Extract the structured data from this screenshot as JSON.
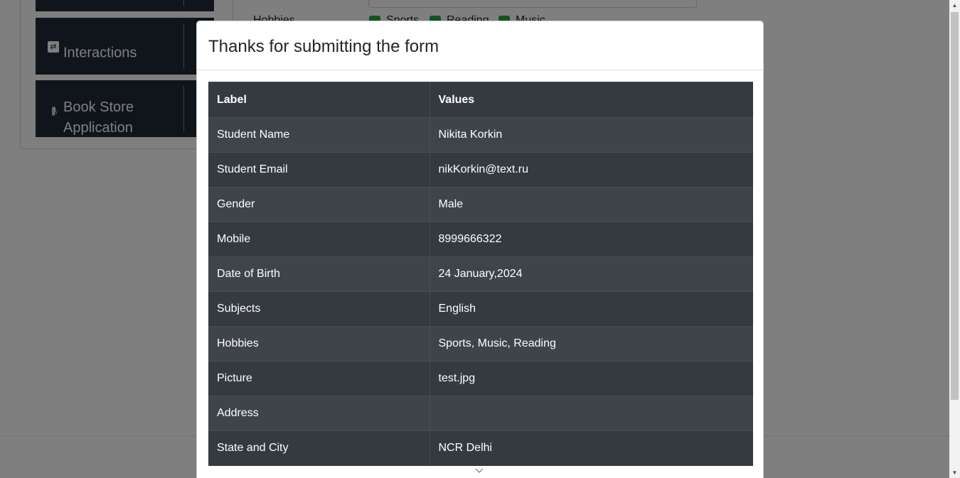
{
  "background": {
    "sidebar": {
      "groups": [
        {
          "label": "",
          "icon": ""
        },
        {
          "label": "Interactions",
          "icon": "interactions-icon"
        },
        {
          "label": "Book Store Application",
          "icon": "book-store-icon"
        }
      ]
    },
    "form": {
      "hobbies_label": "Hobbies",
      "hobby_options": [
        "Sports",
        "Reading",
        "Music"
      ]
    }
  },
  "modal": {
    "title": "Thanks for submitting the form",
    "table": {
      "headers": [
        "Label",
        "Values"
      ],
      "rows": [
        {
          "label": "Student Name",
          "value": "Nikita Korkin"
        },
        {
          "label": "Student Email",
          "value": "nikKorkin@text.ru"
        },
        {
          "label": "Gender",
          "value": "Male"
        },
        {
          "label": "Mobile",
          "value": "8999666322"
        },
        {
          "label": "Date of Birth",
          "value": "24 January,2024"
        },
        {
          "label": "Subjects",
          "value": "English"
        },
        {
          "label": "Hobbies",
          "value": "Sports, Music, Reading"
        },
        {
          "label": "Picture",
          "value": "test.jpg"
        },
        {
          "label": "Address",
          "value": ""
        },
        {
          "label": "State and City",
          "value": "NCR Delhi"
        }
      ]
    }
  },
  "colors": {
    "table_dark": "#343a40",
    "table_stripe": "#3e444a",
    "sidebar_group": "#1f2a37",
    "checkbox_green": "#28a745"
  }
}
